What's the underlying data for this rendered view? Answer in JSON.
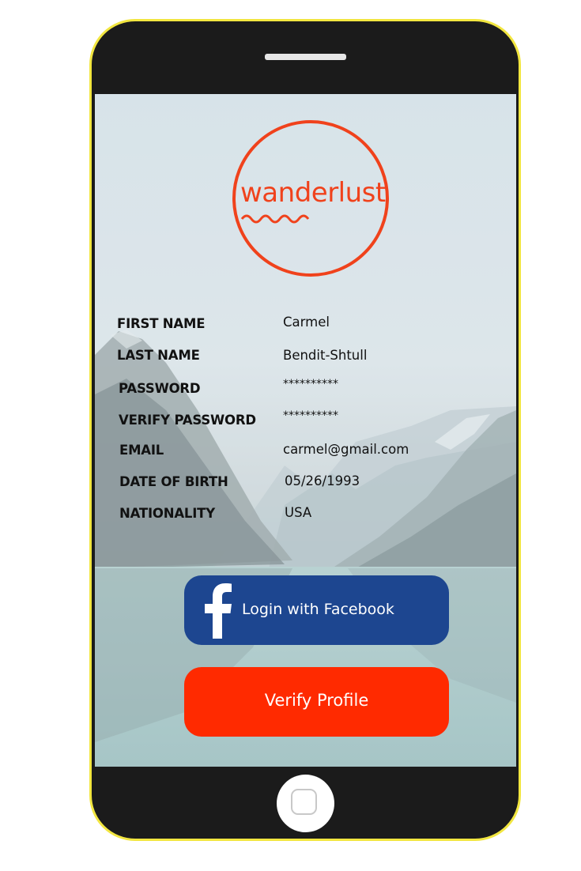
{
  "app": {
    "logo_text": "wanderlust",
    "accent_color": "#f0421c"
  },
  "form": {
    "fields": [
      {
        "label": "FIRST NAME",
        "value": "Carmel"
      },
      {
        "label": "LAST NAME",
        "value": "Bendit-Shtull"
      },
      {
        "label": "PASSWORD",
        "value": "**********"
      },
      {
        "label": "VERIFY PASSWORD",
        "value": "**********"
      },
      {
        "label": "EMAIL",
        "value": "carmel@gmail.com"
      },
      {
        "label": "DATE OF BIRTH",
        "value": "05/26/1993"
      },
      {
        "label": "NATIONALITY",
        "value": "USA"
      }
    ]
  },
  "buttons": {
    "facebook_label": "Login with Facebook",
    "facebook_icon": "facebook-f-icon",
    "facebook_color": "#1d4690",
    "verify_label": "Verify Profile",
    "verify_color": "#ff2a00"
  },
  "device": {
    "frame_color": "#1b1b1b",
    "frame_outline": "#f2e640",
    "home_button_icon": "home-square-icon"
  }
}
